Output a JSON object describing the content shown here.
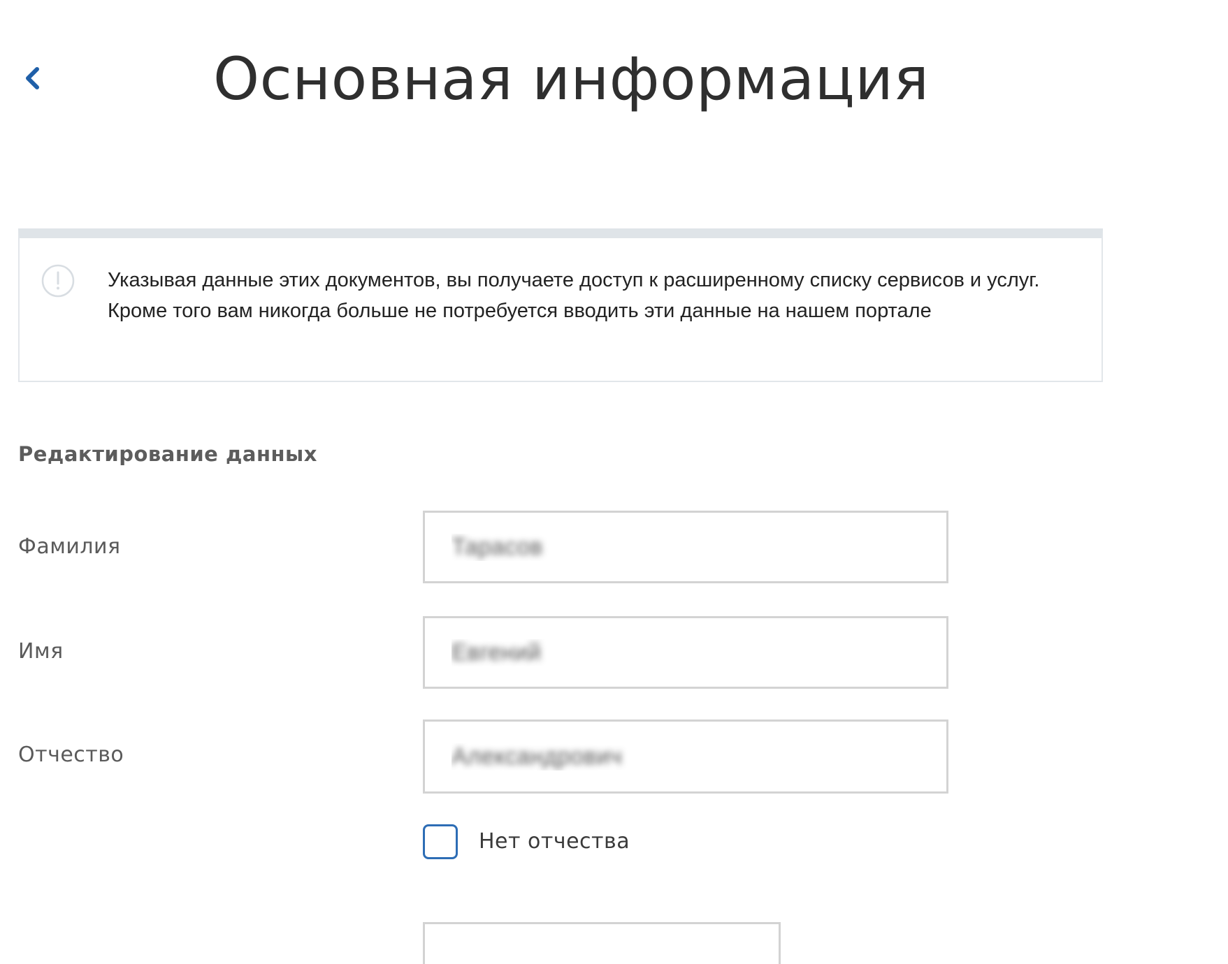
{
  "header": {
    "title": "Основная информация",
    "back_icon": "chevron-left-icon",
    "accent_color": "#1f5fa8"
  },
  "notice": {
    "icon": "exclamation-circle-icon",
    "text": "Указывая данные этих документов, вы получаете доступ к расширенному списку сервисов и услуг. Кроме того вам никогда больше не потребуется вводить эти данные на нашем портале"
  },
  "form": {
    "section_title": "Редактирование данных",
    "fields": {
      "last_name": {
        "label": "Фамилия",
        "value": "Тарасов"
      },
      "first_name": {
        "label": "Имя",
        "value": "Евгений"
      },
      "middle_name": {
        "label": "Отчество",
        "value": "Александрович"
      }
    },
    "no_middle_name": {
      "label": "Нет отчества",
      "checked": false
    }
  }
}
